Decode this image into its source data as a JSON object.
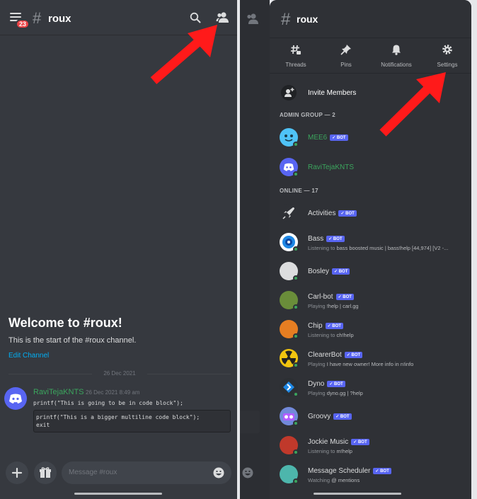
{
  "left": {
    "notification_count": "23",
    "hash": "#",
    "channel": "roux",
    "welcome_title": "Welcome to #roux!",
    "welcome_sub": "This is the start of the #roux channel.",
    "edit_channel": "Edit Channel",
    "date": "26 Dec 2021",
    "message": {
      "author": "RaviTejaKNTS",
      "time": "26 Dec 2021 8:49 am",
      "inline_code": "printf(\"This is going to be in code block\");",
      "code_block_line1": "printf(\"This is a bigger multiline code block\");",
      "code_block_line2": "exit"
    },
    "input_placeholder": "Message #roux"
  },
  "right": {
    "hash": "#",
    "channel": "roux",
    "tabs": [
      {
        "label": "Threads",
        "icon": "threads-icon"
      },
      {
        "label": "Pins",
        "icon": "pin-icon"
      },
      {
        "label": "Notifications",
        "icon": "bell-icon"
      },
      {
        "label": "Settings",
        "icon": "gear-icon"
      }
    ],
    "invite": "Invite Members",
    "admin_header": "ADMIN GROUP — 2",
    "online_header": "ONLINE — 17",
    "bot_label": "✓ BOT",
    "members": [
      {
        "name": "MEE6",
        "status_prefix": "",
        "status": "",
        "color": "#3ba55d",
        "bot": true
      },
      {
        "name": "RaviTejaKNTS",
        "status_prefix": "",
        "status": "",
        "color": "#3ba55d",
        "bot": false
      },
      {
        "name": "Activities",
        "status_prefix": "",
        "status": "",
        "color": "#dcddde",
        "bot": true
      },
      {
        "name": "Bass",
        "status_prefix": "Listening to",
        "status": "bass boosted music | bass!help [44,974] [V2 -...",
        "color": "#dcddde",
        "bot": true
      },
      {
        "name": "Bosley",
        "status_prefix": "",
        "status": "",
        "color": "#dcddde",
        "bot": true
      },
      {
        "name": "Carl-bot",
        "status_prefix": "Playing",
        "status": "!help | carl.gg",
        "color": "#dcddde",
        "bot": true
      },
      {
        "name": "Chip",
        "status_prefix": "Listening to",
        "status": "ch!help",
        "color": "#dcddde",
        "bot": true
      },
      {
        "name": "ClearerBot",
        "status_prefix": "Playing",
        "status": "I have new owner! More info in n!info",
        "color": "#dcddde",
        "bot": true
      },
      {
        "name": "Dyno",
        "status_prefix": "Playing",
        "status": "dyno.gg | ?help",
        "color": "#dcddde",
        "bot": true
      },
      {
        "name": "Groovy",
        "status_prefix": "",
        "status": "",
        "color": "#dcddde",
        "bot": true
      },
      {
        "name": "Jockie Music",
        "status_prefix": "Listening to",
        "status": "m!help",
        "color": "#dcddde",
        "bot": true
      },
      {
        "name": "Message Scheduler",
        "status_prefix": "Watching",
        "status": "@ mentions",
        "color": "#dcddde",
        "bot": true
      }
    ]
  }
}
